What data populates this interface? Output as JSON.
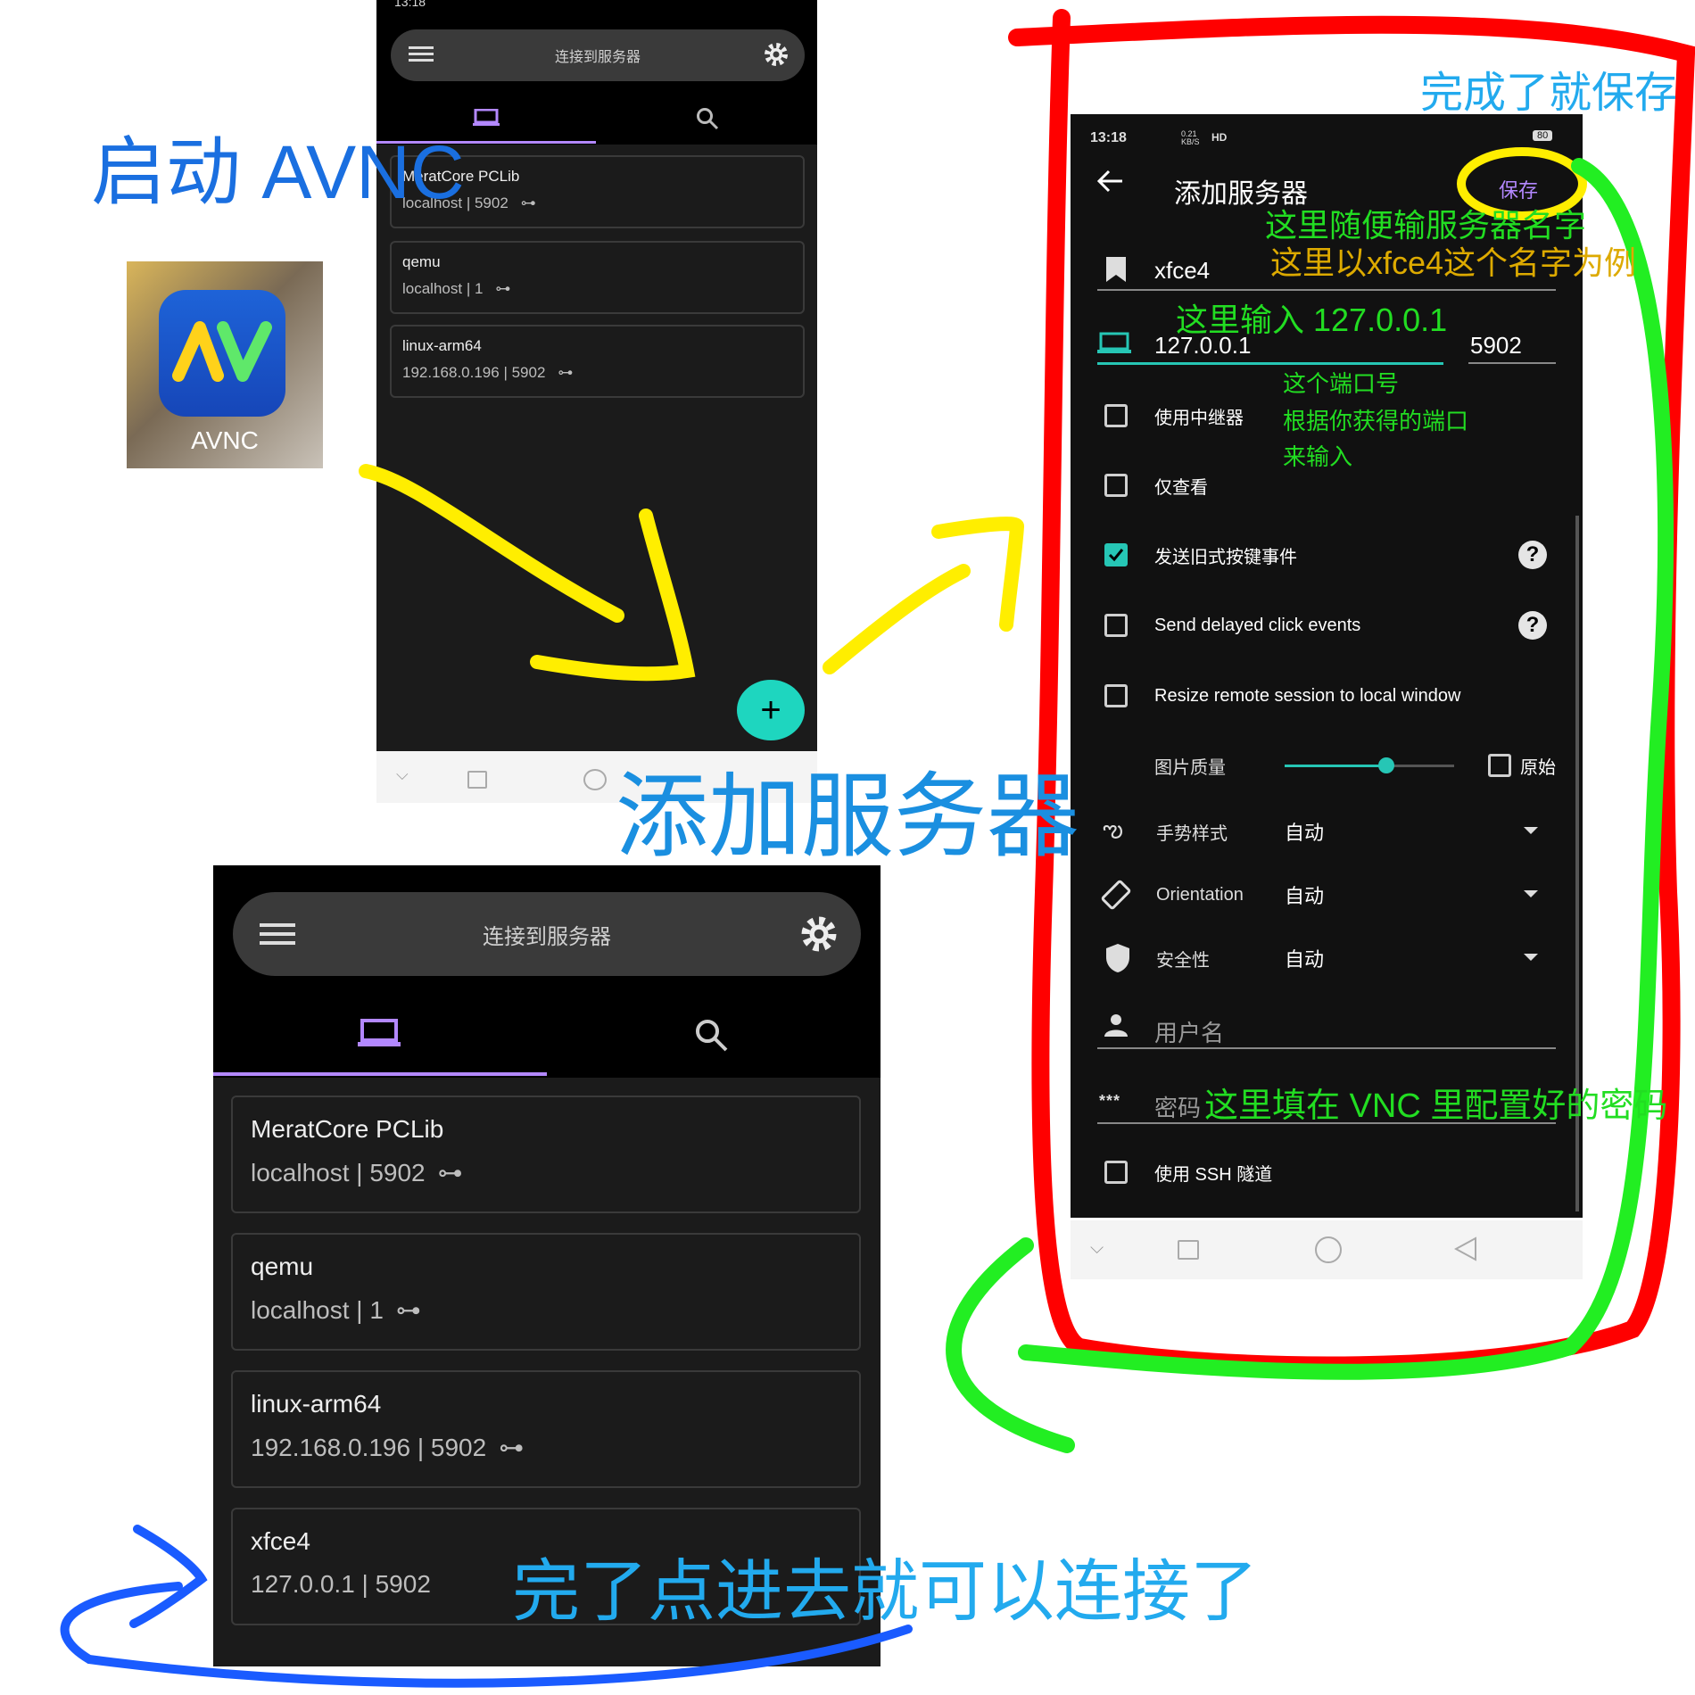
{
  "launch": {
    "label": "启动 AVNC",
    "app_name": "AVNC"
  },
  "small_phone": {
    "status_time": "13:18",
    "topbar_title": "连接到服务器",
    "servers": [
      {
        "name": "MeratCore PCLib",
        "detail": "localhost | 5902"
      },
      {
        "name": "qemu",
        "detail": "localhost | 1"
      },
      {
        "name": "linux-arm64",
        "detail": "192.168.0.196 | 5902"
      }
    ],
    "fab": "+"
  },
  "add_server_label": "添加服务器",
  "form": {
    "status_time": "13:18",
    "status_speed": "0.21 KB/S",
    "status_hd": "HD",
    "battery": "80",
    "title": "添加服务器",
    "save": "保存",
    "name_value": "xfce4",
    "host_value": "127.0.0.1",
    "port_value": "5902",
    "repeater": "使用中继器",
    "view_only": "仅查看",
    "legacy_keys": "发送旧式按键事件",
    "delayed_click": "Send delayed click events",
    "resize": "Resize remote session to local window",
    "image_quality": "图片质量",
    "quality_level": 0.6,
    "raw": "原始",
    "gesture_label": "手势样式",
    "gesture_value": "自动",
    "orientation_label": "Orientation",
    "orientation_value": "自动",
    "security_label": "安全性",
    "security_value": "自动",
    "username_placeholder": "用户名",
    "password_placeholder": "密码",
    "ssh": "使用 SSH 隧道"
  },
  "annotations": {
    "save_done": "完成了就保存",
    "name_hint_1": "这里随便输服务器名字",
    "name_hint_2": "这里以xfce4这个名字为例",
    "host_hint": "这里输入 127.0.0.1",
    "port_hint_1": "这个端口号",
    "port_hint_2": "根据你获得的端口",
    "port_hint_3": "来输入",
    "password_hint": "这里填在 VNC 里配置好的密码",
    "connect_hint": "完了点进去就可以连接了"
  },
  "large_phone": {
    "topbar_title": "连接到服务器",
    "servers": [
      {
        "name": "MeratCore PCLib",
        "detail": "localhost | 5902"
      },
      {
        "name": "qemu",
        "detail": "localhost | 1"
      },
      {
        "name": "linux-arm64",
        "detail": "192.168.0.196 | 5902"
      },
      {
        "name": "xfce4",
        "detail": "127.0.0.1 | 5902"
      }
    ]
  },
  "colors": {
    "accent_teal": "#26c6b5",
    "tab_purple": "#b388ff",
    "annotation_green": "#22dd22",
    "annotation_blue": "#1a8fe0",
    "marker_red": "#ff0000",
    "marker_yellow": "#ffee00"
  }
}
